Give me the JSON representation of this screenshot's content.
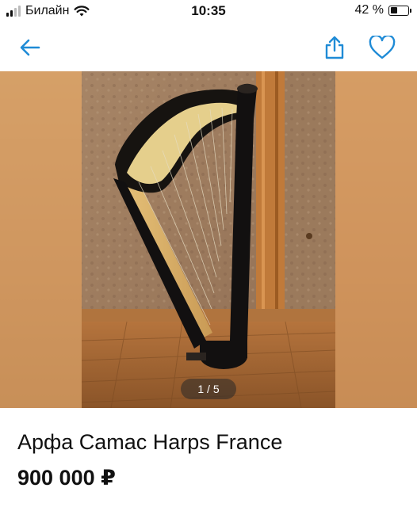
{
  "status_bar": {
    "carrier": "Билайн",
    "time": "10:35",
    "battery_percent": "42 %",
    "battery_level": 0.42
  },
  "nav": {
    "back_icon": "arrow-left-icon",
    "share_icon": "share-icon",
    "favorite_icon": "heart-icon",
    "accent_color": "#1f8bd6"
  },
  "gallery": {
    "counter": "1 / 5",
    "current_index": 1,
    "total": 5
  },
  "listing": {
    "title": "Арфа Camac Harps France",
    "price": "900 000 ₽"
  }
}
